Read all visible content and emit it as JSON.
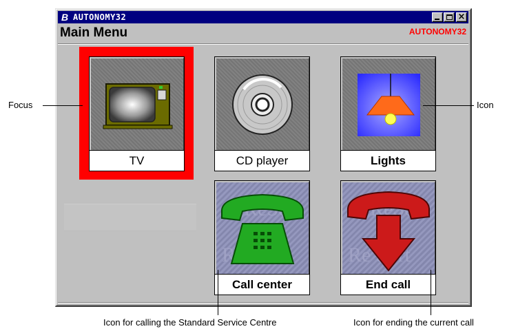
{
  "window": {
    "app_glyph": "B",
    "title": "AUTONOMY32",
    "title_buttons": [
      "minimize",
      "maximize",
      "close"
    ],
    "close_glyph": "×",
    "heading": "Main Menu",
    "brand": "AUTONOMY32"
  },
  "tiles": [
    {
      "label": "TV",
      "icon": "tv-icon",
      "focused": true
    },
    {
      "label": "CD player",
      "icon": "cd-icon",
      "focused": false
    },
    {
      "label": "Lights",
      "icon": "lamp-icon",
      "focused": false
    },
    {
      "label": "Call center",
      "icon": "phone-call-icon",
      "focused": false
    },
    {
      "label": "End call",
      "icon": "phone-hangup-icon",
      "focused": false
    }
  ],
  "annotations": {
    "focus": "Focus",
    "icon": "Icon",
    "call_center": "Icon for calling the Standard Service Centre",
    "end_call": "Icon for ending the current call"
  },
  "colors": {
    "focus": "#ff0000",
    "titlebar": "#000080",
    "brand": "#ff0000",
    "window": "#c0c0c0"
  }
}
